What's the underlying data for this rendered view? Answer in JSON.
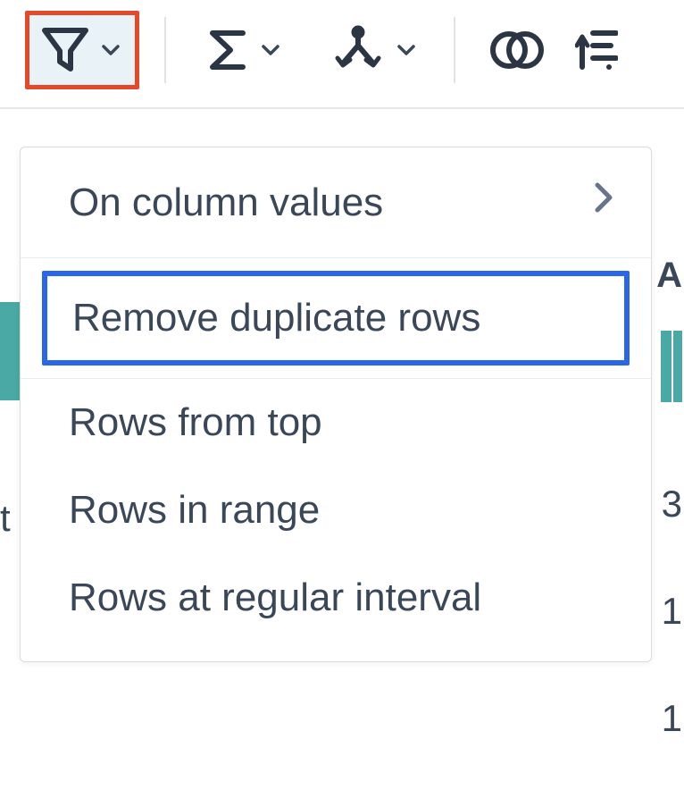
{
  "toolbar": {
    "filter": {
      "name": "filter"
    },
    "sigma": {
      "name": "aggregate"
    },
    "split": {
      "name": "split"
    },
    "join": {
      "name": "join"
    },
    "sort": {
      "name": "sort"
    }
  },
  "menu": {
    "items": [
      {
        "label": "On column values",
        "has_submenu": true
      },
      {
        "label": "Remove duplicate rows",
        "highlighted": true
      },
      {
        "label": "Rows from top"
      },
      {
        "label": "Rows in range"
      },
      {
        "label": "Rows at regular interval"
      }
    ]
  },
  "bg": {
    "right_header": "A",
    "cells": [
      "3",
      "1",
      "1"
    ],
    "left_char": "t"
  }
}
